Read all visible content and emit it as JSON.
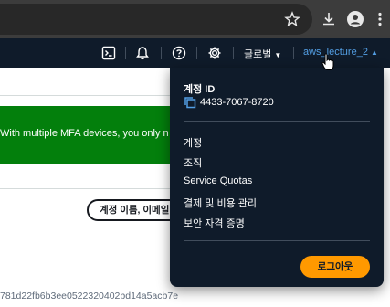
{
  "browser": {
    "icons": [
      "star-icon",
      "download-icon",
      "profile-icon",
      "more-vert-icon"
    ]
  },
  "nav": {
    "icons": [
      "cloudshell-icon",
      "bell-icon",
      "help-icon",
      "gear-icon"
    ],
    "region_label": "글로벌",
    "account_label": "aws_lecture_2",
    "account_color": "#539fe5"
  },
  "main": {
    "banner_text": "With multiple MFA devices, you only n",
    "banner_color": "#037f0c",
    "search_placeholder": "계정 이름, 이메일",
    "hash_text": "781d22fb6b3ee0522320402bd14a5acb7e"
  },
  "account_menu": {
    "id_label": "계정 ID",
    "id_value": "4433-7067-8720",
    "items": [
      {
        "label": "계정"
      },
      {
        "label": "조직"
      },
      {
        "label": "Service Quotas"
      },
      {
        "label": "결제 및 비용 관리"
      },
      {
        "label": "보안 자격 증명"
      }
    ],
    "logout_label": "로그아웃",
    "logout_color": "#ff9900"
  }
}
